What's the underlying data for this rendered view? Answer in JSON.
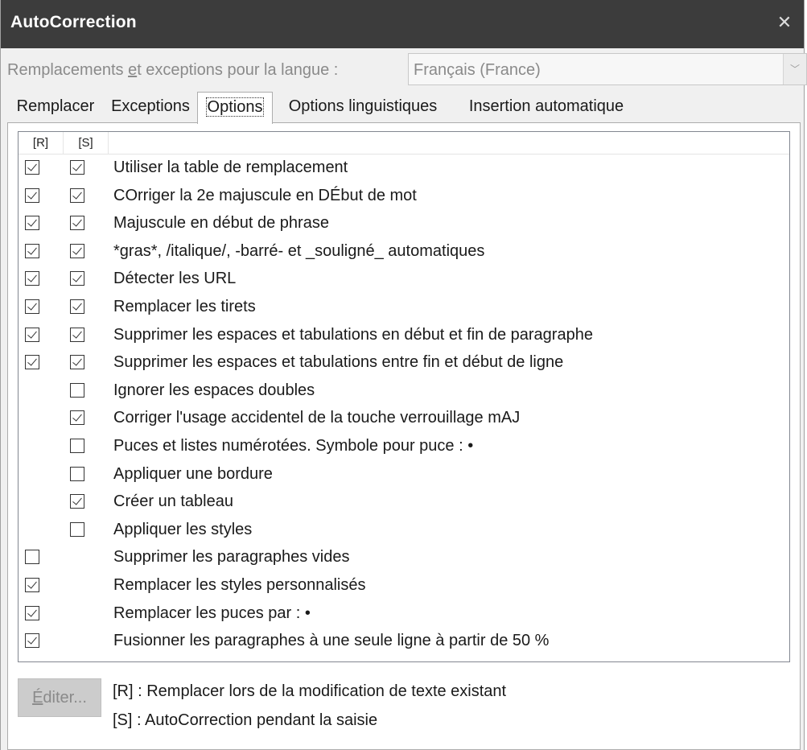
{
  "window": {
    "title": "AutoCorrection",
    "close_icon": "close-icon"
  },
  "language": {
    "label_before": "Remplacements ",
    "label_accel": "e",
    "label_after": "t exceptions pour la langue :",
    "selected": "Français (France)"
  },
  "tabs": [
    {
      "label": "Remplacer",
      "active": false
    },
    {
      "label": "Exceptions",
      "active": false
    },
    {
      "label": "Options",
      "active": true
    },
    {
      "label": "Options linguistiques",
      "active": false
    },
    {
      "label": "Insertion automatique",
      "active": false
    }
  ],
  "list": {
    "headers": {
      "r": "[R]",
      "s": "[S]",
      "label": ""
    },
    "rows": [
      {
        "r": true,
        "s": true,
        "label": "Utiliser la table de remplacement"
      },
      {
        "r": true,
        "s": true,
        "label": "COrriger la 2e majuscule en DÉbut de mot"
      },
      {
        "r": true,
        "s": true,
        "label": "Majuscule en début de phrase"
      },
      {
        "r": true,
        "s": true,
        "label": "*gras*, /italique/, -barré- et _souligné_ automatiques"
      },
      {
        "r": true,
        "s": true,
        "label": "Détecter les URL"
      },
      {
        "r": true,
        "s": true,
        "label": "Remplacer les tirets"
      },
      {
        "r": true,
        "s": true,
        "label": "Supprimer les espaces et tabulations en début et fin de paragraphe"
      },
      {
        "r": true,
        "s": true,
        "label": "Supprimer les espaces et tabulations entre fin et début de ligne"
      },
      {
        "r": null,
        "s": false,
        "label": "Ignorer les espaces doubles"
      },
      {
        "r": null,
        "s": true,
        "label": "Corriger l'usage accidentel de la touche verrouillage mAJ"
      },
      {
        "r": null,
        "s": false,
        "label": "Puces et listes numérotées. Symbole pour puce : •"
      },
      {
        "r": null,
        "s": false,
        "label": "Appliquer une bordure"
      },
      {
        "r": null,
        "s": true,
        "label": "Créer un tableau"
      },
      {
        "r": null,
        "s": false,
        "label": "Appliquer les styles"
      },
      {
        "r": false,
        "s": null,
        "label": "Supprimer les paragraphes vides"
      },
      {
        "r": true,
        "s": null,
        "label": "Remplacer les styles personnalisés"
      },
      {
        "r": true,
        "s": null,
        "label": "Remplacer les puces par : •"
      },
      {
        "r": true,
        "s": null,
        "label": "Fusionner les paragraphes à une seule ligne à partir de 50 %"
      }
    ]
  },
  "edit_button": {
    "accel": "É",
    "rest": "diter..."
  },
  "legend": {
    "r": "[R] : Remplacer lors de la modification de texte existant",
    "s": "[S] : AutoCorrection pendant la saisie"
  }
}
